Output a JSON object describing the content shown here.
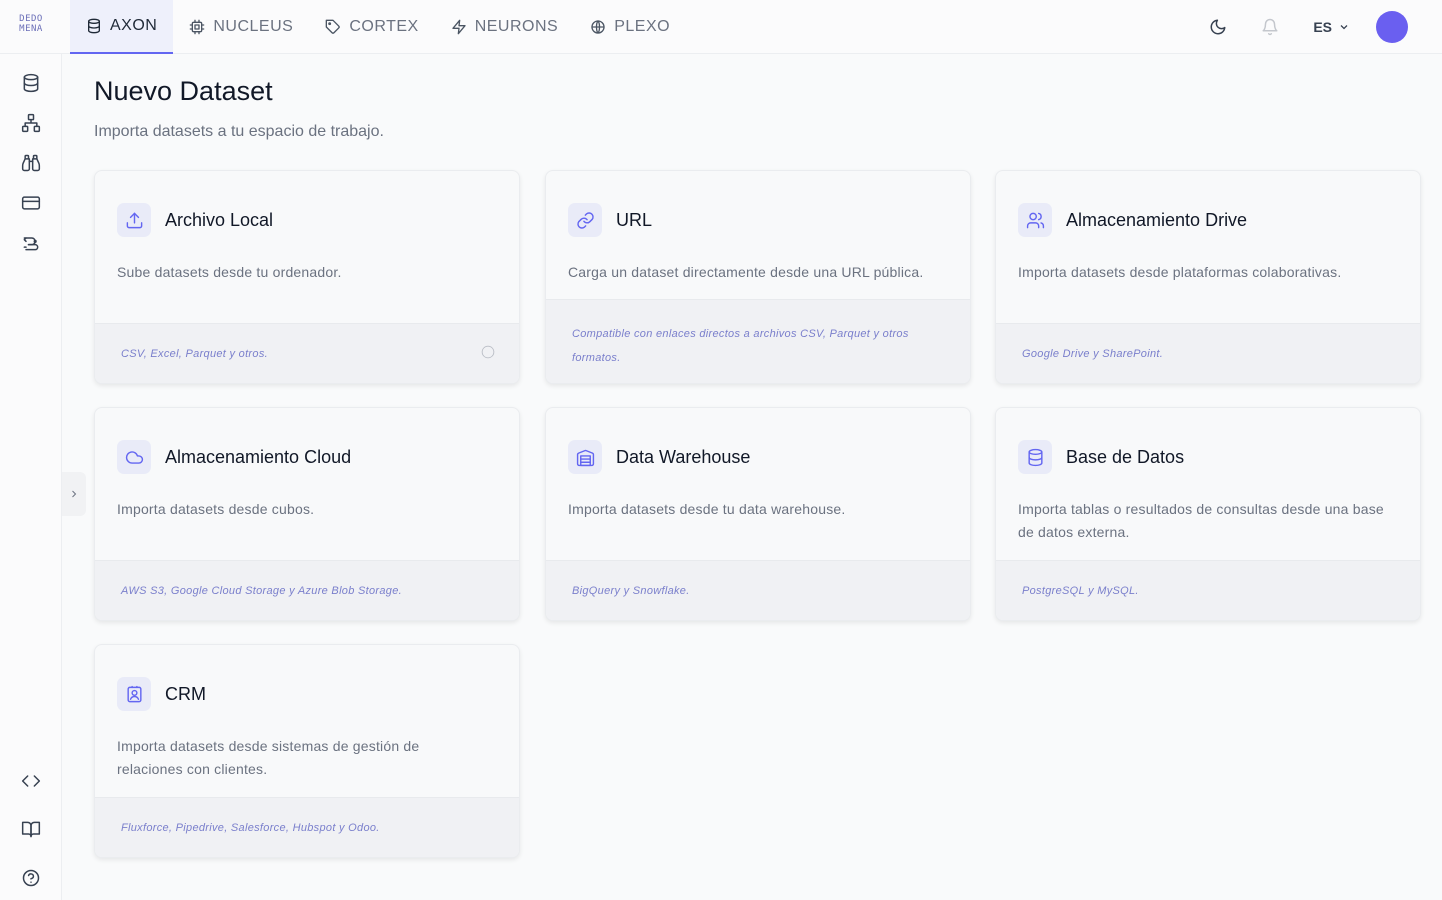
{
  "logo": {
    "line1": "DEDO",
    "line2": "MENA"
  },
  "nav": {
    "tabs": [
      {
        "label": "AXON",
        "icon": "database-icon",
        "active": true
      },
      {
        "label": "NUCLEUS",
        "icon": "cpu-icon",
        "active": false
      },
      {
        "label": "CORTEX",
        "icon": "tag-icon",
        "active": false
      },
      {
        "label": "NEURONS",
        "icon": "lightning-icon",
        "active": false
      },
      {
        "label": "PLEXO",
        "icon": "globe-icon",
        "active": false
      }
    ],
    "language": "ES"
  },
  "sidebar": {
    "top_icons": [
      "database-icon",
      "hierarchy-icon",
      "binoculars-icon",
      "card-icon",
      "brain-icon"
    ],
    "bottom_icons": [
      "code-icon",
      "book-icon",
      "help-icon"
    ]
  },
  "header": {
    "title": "Nuevo Dataset",
    "subtitle": "Importa datasets a tu espacio de trabajo."
  },
  "cards": [
    {
      "title": "Archivo Local",
      "description": "Sube datasets desde tu ordenador.",
      "footer": "CSV, Excel, Parquet y otros.",
      "icon": "upload-icon"
    },
    {
      "title": "URL",
      "description": "Carga un dataset directamente desde una URL pública.",
      "footer": "Compatible con enlaces directos a archivos CSV, Parquet y otros formatos.",
      "icon": "link-icon"
    },
    {
      "title": "Almacenamiento Drive",
      "description": "Importa datasets desde plataformas colaborativas.",
      "footer": "Google Drive y SharePoint.",
      "icon": "users-icon"
    },
    {
      "title": "Almacenamiento Cloud",
      "description": "Importa datasets desde cubos.",
      "footer": "AWS S3, Google Cloud Storage y Azure Blob Storage.",
      "icon": "cloud-icon"
    },
    {
      "title": "Data Warehouse",
      "description": "Importa datasets desde tu data warehouse.",
      "footer": "BigQuery y Snowflake.",
      "icon": "warehouse-icon"
    },
    {
      "title": "Base de Datos",
      "description": "Importa tablas o resultados de consultas desde una base de datos externa.",
      "footer": "PostgreSQL y MySQL.",
      "icon": "database-icon"
    },
    {
      "title": "CRM",
      "description": "Importa datasets desde sistemas de gestión de relaciones con clientes.",
      "footer": "Fluxforce, Pipedrive, Salesforce, Hubspot y Odoo.",
      "icon": "contact-icon"
    }
  ],
  "colors": {
    "accent": "#6366f1",
    "avatar": "#6a5ff0"
  }
}
